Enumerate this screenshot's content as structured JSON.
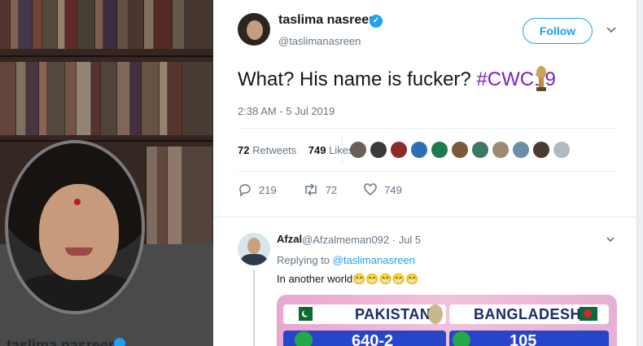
{
  "profile_panel": {
    "name": "taslima nasreen"
  },
  "tweet": {
    "author_name": "taslima nasreen",
    "handle": "@taslimanasreen",
    "follow_label": "Follow",
    "text": "What? His name is fucker? ",
    "hashtag": "#CWC19",
    "timestamp": "2:38 AM - 5 Jul 2019",
    "retweets_count": "72",
    "retweets_label": "Retweets",
    "likes_count": "749",
    "likes_label": "Likes",
    "liker_colors": [
      "#6b5f57",
      "#3a3a3a",
      "#8a2b2b",
      "#2f6db5",
      "#1f7a4d",
      "#7b5a3a",
      "#3b7a62",
      "#9a8a74",
      "#6a8fa6",
      "#4a3a30",
      "#b0bac2"
    ],
    "actions": {
      "reply_count": "219",
      "retweet_count": "72",
      "like_count": "749"
    },
    "colors": {
      "link_blue": "#1da1f2",
      "hashtag_purple": "#7a1fc2"
    }
  },
  "reply": {
    "name": "Afzal",
    "handle_date": "@Afzalmeman092 · Jul 5",
    "replying_prefix": "Replying to ",
    "replying_to": "@taslimanasreen",
    "text": "In another world😁😁😁😁😁",
    "media": {
      "team1": "PAKISTAN",
      "team2": "BANGLADESH",
      "score1": "640-2",
      "score2": "105"
    }
  }
}
